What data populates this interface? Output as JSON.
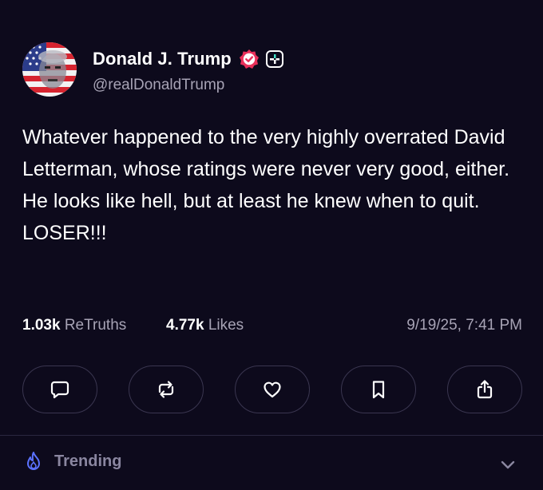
{
  "post": {
    "author_name": "Donald J. Trump",
    "author_handle": "@realDonaldTrump",
    "text": "Whatever happened to the very highly overrated David Letterman, whose ratings were never very good, either. He looks like hell, but at least he knew when to quit. LOSER!!!",
    "stats": {
      "retruths_count": "1.03k",
      "retruths_label": "ReTruths",
      "likes_count": "4.77k",
      "likes_label": "Likes",
      "timestamp": "9/19/25, 7:41 PM"
    }
  },
  "actions": {
    "icons": [
      "comment-icon",
      "retruth-icon",
      "heart-icon",
      "bookmark-icon",
      "share-icon"
    ]
  },
  "footer": {
    "trending_label": "Trending"
  },
  "colors": {
    "background": "#0d0a1c",
    "secondary_text": "#a7a3b5",
    "verified_badge": "#e8305a",
    "trending_icon": "#5b72ff",
    "border": "#3a3650"
  }
}
